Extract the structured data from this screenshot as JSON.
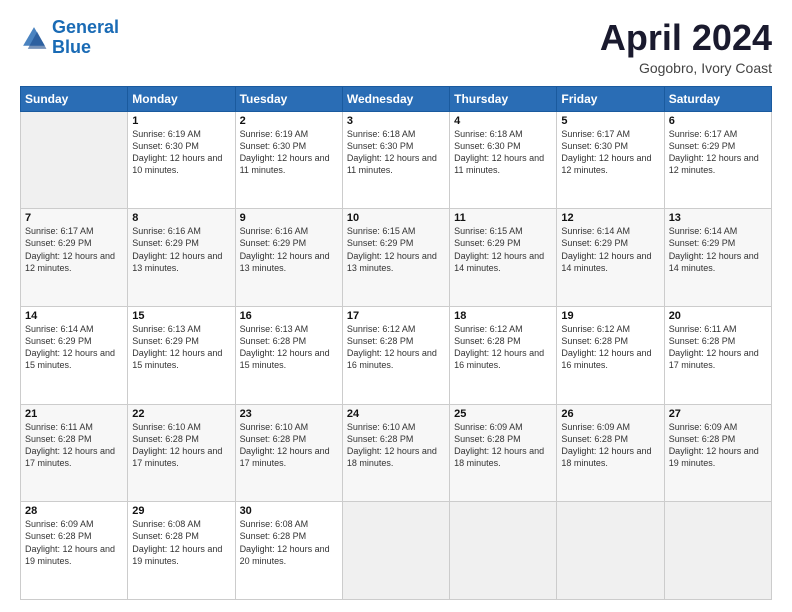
{
  "logo": {
    "line1": "General",
    "line2": "Blue"
  },
  "title": "April 2024",
  "subtitle": "Gogobro, Ivory Coast",
  "days": [
    "Sunday",
    "Monday",
    "Tuesday",
    "Wednesday",
    "Thursday",
    "Friday",
    "Saturday"
  ],
  "weeks": [
    [
      {
        "num": "",
        "sunrise": "",
        "sunset": "",
        "daylight": ""
      },
      {
        "num": "1",
        "sunrise": "Sunrise: 6:19 AM",
        "sunset": "Sunset: 6:30 PM",
        "daylight": "Daylight: 12 hours and 10 minutes."
      },
      {
        "num": "2",
        "sunrise": "Sunrise: 6:19 AM",
        "sunset": "Sunset: 6:30 PM",
        "daylight": "Daylight: 12 hours and 11 minutes."
      },
      {
        "num": "3",
        "sunrise": "Sunrise: 6:18 AM",
        "sunset": "Sunset: 6:30 PM",
        "daylight": "Daylight: 12 hours and 11 minutes."
      },
      {
        "num": "4",
        "sunrise": "Sunrise: 6:18 AM",
        "sunset": "Sunset: 6:30 PM",
        "daylight": "Daylight: 12 hours and 11 minutes."
      },
      {
        "num": "5",
        "sunrise": "Sunrise: 6:17 AM",
        "sunset": "Sunset: 6:30 PM",
        "daylight": "Daylight: 12 hours and 12 minutes."
      },
      {
        "num": "6",
        "sunrise": "Sunrise: 6:17 AM",
        "sunset": "Sunset: 6:29 PM",
        "daylight": "Daylight: 12 hours and 12 minutes."
      }
    ],
    [
      {
        "num": "7",
        "sunrise": "Sunrise: 6:17 AM",
        "sunset": "Sunset: 6:29 PM",
        "daylight": "Daylight: 12 hours and 12 minutes."
      },
      {
        "num": "8",
        "sunrise": "Sunrise: 6:16 AM",
        "sunset": "Sunset: 6:29 PM",
        "daylight": "Daylight: 12 hours and 13 minutes."
      },
      {
        "num": "9",
        "sunrise": "Sunrise: 6:16 AM",
        "sunset": "Sunset: 6:29 PM",
        "daylight": "Daylight: 12 hours and 13 minutes."
      },
      {
        "num": "10",
        "sunrise": "Sunrise: 6:15 AM",
        "sunset": "Sunset: 6:29 PM",
        "daylight": "Daylight: 12 hours and 13 minutes."
      },
      {
        "num": "11",
        "sunrise": "Sunrise: 6:15 AM",
        "sunset": "Sunset: 6:29 PM",
        "daylight": "Daylight: 12 hours and 14 minutes."
      },
      {
        "num": "12",
        "sunrise": "Sunrise: 6:14 AM",
        "sunset": "Sunset: 6:29 PM",
        "daylight": "Daylight: 12 hours and 14 minutes."
      },
      {
        "num": "13",
        "sunrise": "Sunrise: 6:14 AM",
        "sunset": "Sunset: 6:29 PM",
        "daylight": "Daylight: 12 hours and 14 minutes."
      }
    ],
    [
      {
        "num": "14",
        "sunrise": "Sunrise: 6:14 AM",
        "sunset": "Sunset: 6:29 PM",
        "daylight": "Daylight: 12 hours and 15 minutes."
      },
      {
        "num": "15",
        "sunrise": "Sunrise: 6:13 AM",
        "sunset": "Sunset: 6:29 PM",
        "daylight": "Daylight: 12 hours and 15 minutes."
      },
      {
        "num": "16",
        "sunrise": "Sunrise: 6:13 AM",
        "sunset": "Sunset: 6:28 PM",
        "daylight": "Daylight: 12 hours and 15 minutes."
      },
      {
        "num": "17",
        "sunrise": "Sunrise: 6:12 AM",
        "sunset": "Sunset: 6:28 PM",
        "daylight": "Daylight: 12 hours and 16 minutes."
      },
      {
        "num": "18",
        "sunrise": "Sunrise: 6:12 AM",
        "sunset": "Sunset: 6:28 PM",
        "daylight": "Daylight: 12 hours and 16 minutes."
      },
      {
        "num": "19",
        "sunrise": "Sunrise: 6:12 AM",
        "sunset": "Sunset: 6:28 PM",
        "daylight": "Daylight: 12 hours and 16 minutes."
      },
      {
        "num": "20",
        "sunrise": "Sunrise: 6:11 AM",
        "sunset": "Sunset: 6:28 PM",
        "daylight": "Daylight: 12 hours and 17 minutes."
      }
    ],
    [
      {
        "num": "21",
        "sunrise": "Sunrise: 6:11 AM",
        "sunset": "Sunset: 6:28 PM",
        "daylight": "Daylight: 12 hours and 17 minutes."
      },
      {
        "num": "22",
        "sunrise": "Sunrise: 6:10 AM",
        "sunset": "Sunset: 6:28 PM",
        "daylight": "Daylight: 12 hours and 17 minutes."
      },
      {
        "num": "23",
        "sunrise": "Sunrise: 6:10 AM",
        "sunset": "Sunset: 6:28 PM",
        "daylight": "Daylight: 12 hours and 17 minutes."
      },
      {
        "num": "24",
        "sunrise": "Sunrise: 6:10 AM",
        "sunset": "Sunset: 6:28 PM",
        "daylight": "Daylight: 12 hours and 18 minutes."
      },
      {
        "num": "25",
        "sunrise": "Sunrise: 6:09 AM",
        "sunset": "Sunset: 6:28 PM",
        "daylight": "Daylight: 12 hours and 18 minutes."
      },
      {
        "num": "26",
        "sunrise": "Sunrise: 6:09 AM",
        "sunset": "Sunset: 6:28 PM",
        "daylight": "Daylight: 12 hours and 18 minutes."
      },
      {
        "num": "27",
        "sunrise": "Sunrise: 6:09 AM",
        "sunset": "Sunset: 6:28 PM",
        "daylight": "Daylight: 12 hours and 19 minutes."
      }
    ],
    [
      {
        "num": "28",
        "sunrise": "Sunrise: 6:09 AM",
        "sunset": "Sunset: 6:28 PM",
        "daylight": "Daylight: 12 hours and 19 minutes."
      },
      {
        "num": "29",
        "sunrise": "Sunrise: 6:08 AM",
        "sunset": "Sunset: 6:28 PM",
        "daylight": "Daylight: 12 hours and 19 minutes."
      },
      {
        "num": "30",
        "sunrise": "Sunrise: 6:08 AM",
        "sunset": "Sunset: 6:28 PM",
        "daylight": "Daylight: 12 hours and 20 minutes."
      },
      {
        "num": "",
        "sunrise": "",
        "sunset": "",
        "daylight": ""
      },
      {
        "num": "",
        "sunrise": "",
        "sunset": "",
        "daylight": ""
      },
      {
        "num": "",
        "sunrise": "",
        "sunset": "",
        "daylight": ""
      },
      {
        "num": "",
        "sunrise": "",
        "sunset": "",
        "daylight": ""
      }
    ]
  ]
}
